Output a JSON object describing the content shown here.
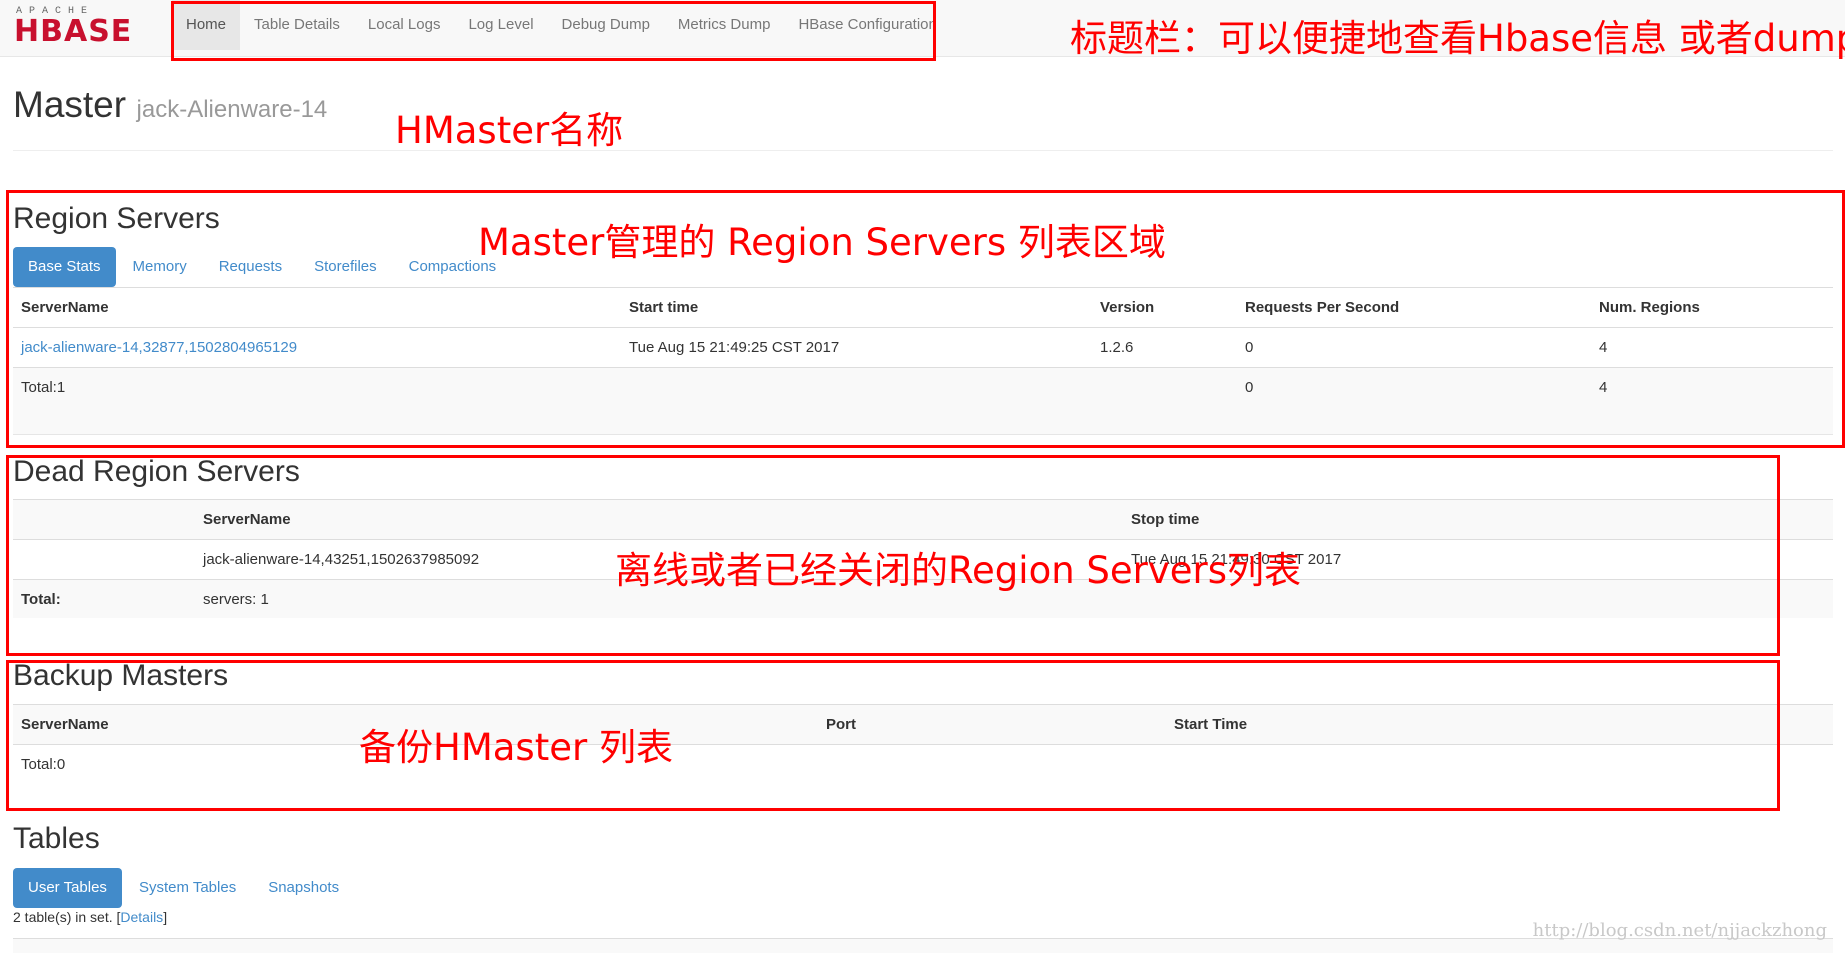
{
  "brand": {
    "apache": "APACHE",
    "hbase": "HBASE"
  },
  "nav": {
    "items": [
      "Home",
      "Table Details",
      "Local Logs",
      "Log Level",
      "Debug Dump",
      "Metrics Dump",
      "HBase Configuration"
    ],
    "active": "Home"
  },
  "master": {
    "title": "Master",
    "host": "jack-Alienware-14"
  },
  "region_servers": {
    "heading": "Region Servers",
    "tabs": [
      "Base Stats",
      "Memory",
      "Requests",
      "Storefiles",
      "Compactions"
    ],
    "columns": [
      "ServerName",
      "Start time",
      "Version",
      "Requests Per Second",
      "Num. Regions"
    ],
    "rows": [
      {
        "server": "jack-alienware-14,32877,1502804965129",
        "start": "Tue Aug 15 21:49:25 CST 2017",
        "version": "1.2.6",
        "rps": "0",
        "regions": "4"
      }
    ],
    "total": {
      "label": "Total:1",
      "rps": "0",
      "regions": "4"
    }
  },
  "dead_region_servers": {
    "heading": "Dead Region Servers",
    "columns": [
      "",
      "ServerName",
      "Stop time"
    ],
    "rows": [
      {
        "server": "jack-alienware-14,43251,1502637985092",
        "stop": "Tue Aug 15 21:49:30 CST 2017"
      }
    ],
    "total": {
      "label": "Total:",
      "servers": "servers: 1"
    }
  },
  "backup_masters": {
    "heading": "Backup Masters",
    "columns": [
      "ServerName",
      "Port",
      "Start Time"
    ],
    "total": "Total:0"
  },
  "tables": {
    "heading": "Tables",
    "tabs": [
      "User Tables",
      "System Tables",
      "Snapshots"
    ],
    "count_text": "2 table(s) in set. [",
    "details_link": "Details",
    "close_bracket": "]"
  },
  "annotations": {
    "nav": "标题栏：可以便捷地查看Hbase信息 或者dump",
    "master": "HMaster名称",
    "region_servers": "Master管理的 Region  Servers 列表区域",
    "dead": "离线或者已经关闭的Region  Servers列表",
    "backup": "备份HMaster  列表",
    "color": "#ff0000"
  },
  "watermark": "http://blog.csdn.net/njjackzhong"
}
